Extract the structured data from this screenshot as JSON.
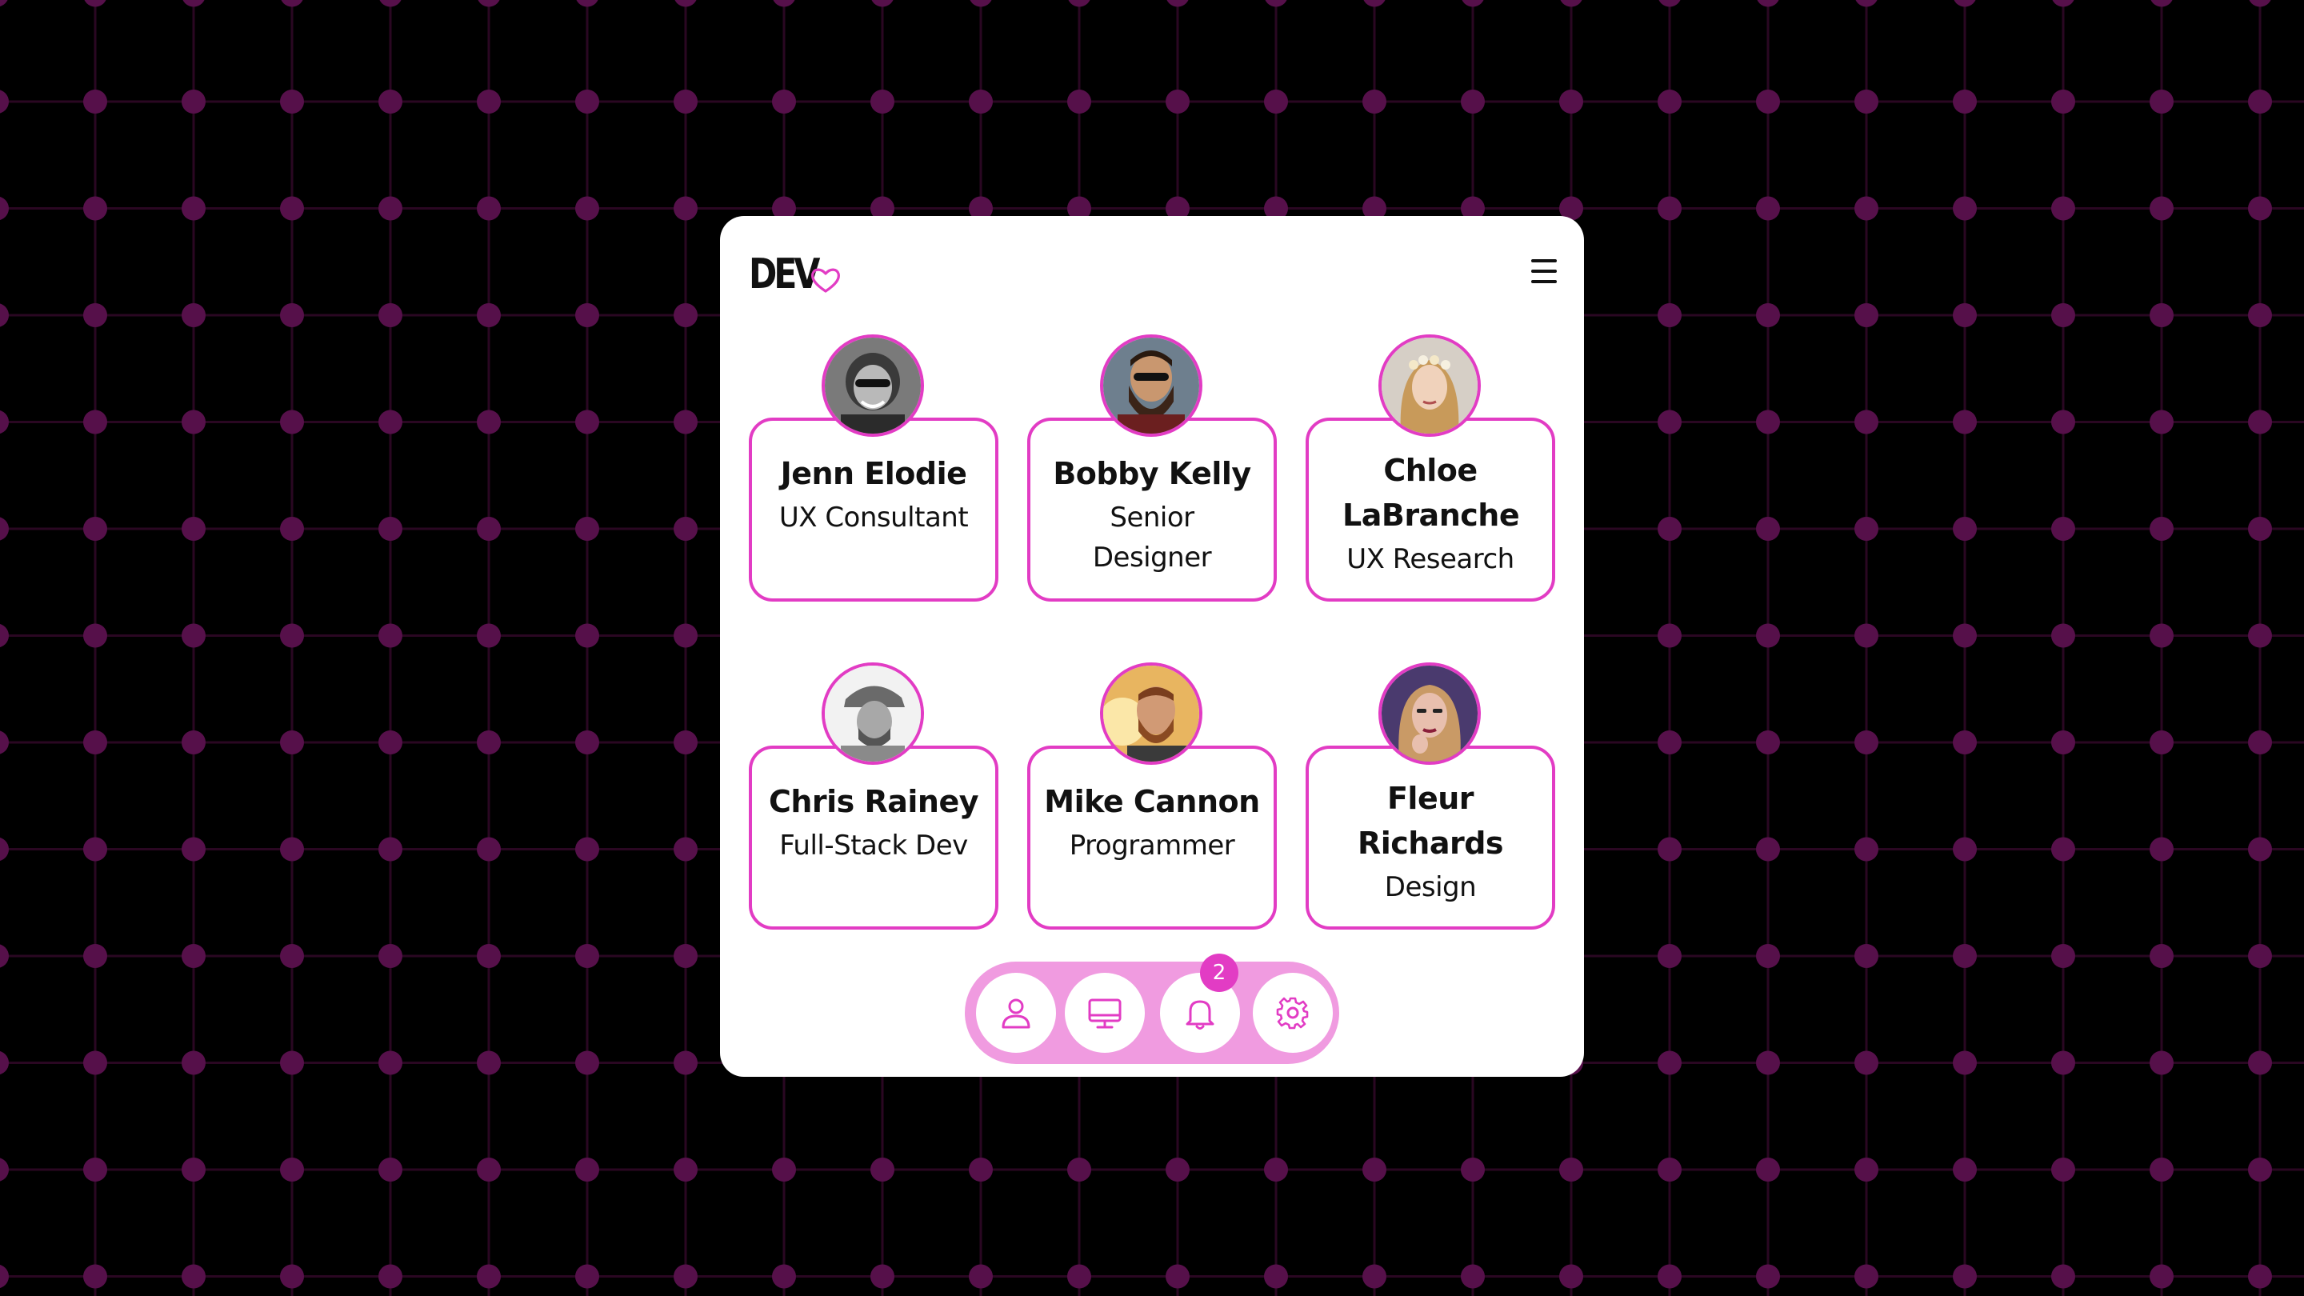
{
  "app": {
    "logo_text": "DEV",
    "accent_color": "#e23cc4",
    "nav_bg_color": "#f09be0"
  },
  "header": {
    "logo_icon": "heart-icon",
    "menu_icon": "hamburger-menu-icon"
  },
  "profiles": [
    {
      "name": "Jenn Elodie",
      "role": "UX Consultant",
      "avatar": "avatar-photo"
    },
    {
      "name": "Bobby Kelly",
      "role": "Senior Designer",
      "avatar": "avatar-photo"
    },
    {
      "name": "Chloe LaBranche",
      "role": "UX Research",
      "avatar": "avatar-photo"
    },
    {
      "name": "Chris Rainey",
      "role": "Full-Stack Dev",
      "avatar": "avatar-photo"
    },
    {
      "name": "Mike Cannon",
      "role": "Programmer",
      "avatar": "avatar-photo"
    },
    {
      "name": "Fleur Richards",
      "role": "Design",
      "avatar": "avatar-photo"
    }
  ],
  "bottom_nav": {
    "items": [
      {
        "icon": "user-icon"
      },
      {
        "icon": "monitor-icon"
      },
      {
        "icon": "bell-icon"
      },
      {
        "icon": "gear-icon"
      }
    ],
    "notification_count": "2"
  }
}
